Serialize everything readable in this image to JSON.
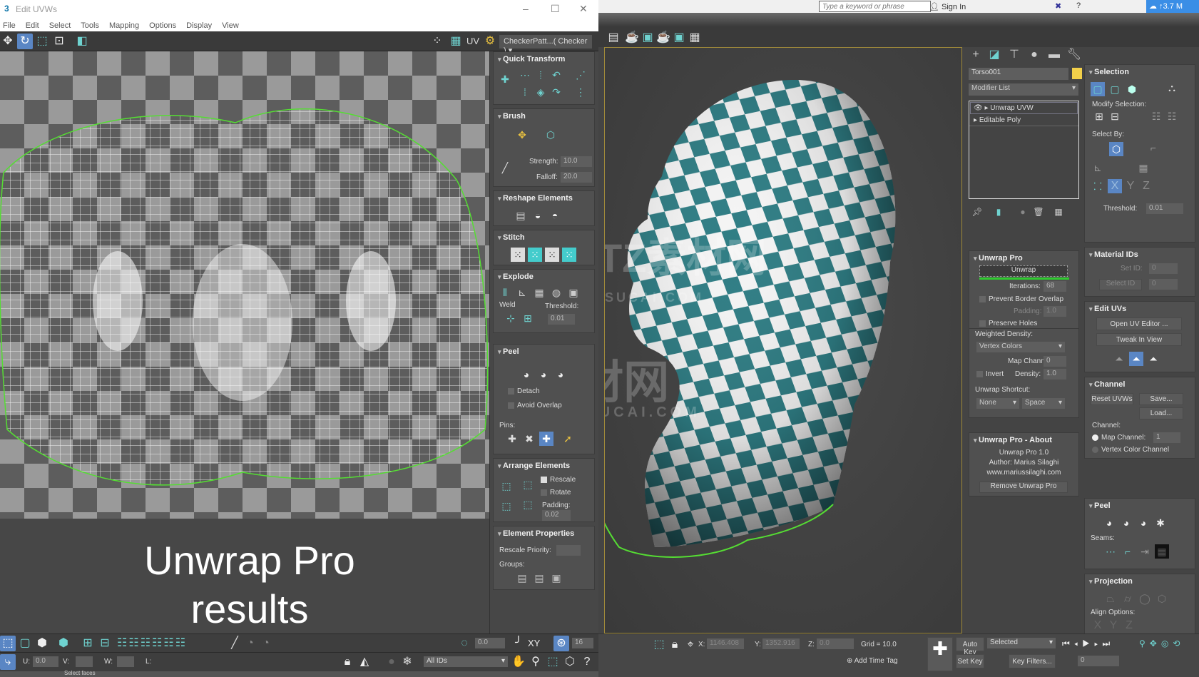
{
  "uv_editor": {
    "title": "Edit UVWs",
    "logo": "3",
    "window_controls": [
      "–",
      "☐",
      "✕"
    ],
    "menu": [
      "File",
      "Edit",
      "Select",
      "Tools",
      "Mapping",
      "Options",
      "Display",
      "View"
    ],
    "uv_label": "UV",
    "checker_select": "CheckerPatt...( Checker )",
    "overlay_text_line1": "Unwrap Pro",
    "overlay_text_line2": "results",
    "rollouts": {
      "quick_transform": "Quick Transform",
      "brush": {
        "title": "Brush",
        "strength_label": "Strength:",
        "strength": "10.0",
        "falloff_label": "Falloff:",
        "falloff": "20.0"
      },
      "reshape": "Reshape Elements",
      "stitch": "Stitch",
      "explode": {
        "title": "Explode",
        "weld": "Weld",
        "threshold_label": "Threshold:",
        "threshold": "0.01"
      },
      "peel": {
        "title": "Peel",
        "detach": "Detach",
        "avoid_overlap": "Avoid Overlap",
        "pins": "Pins:"
      },
      "arrange": {
        "title": "Arrange Elements",
        "rescale": "Rescale",
        "rotate": "Rotate",
        "padding_label": "Padding:",
        "padding": "0.02"
      },
      "element_properties": {
        "title": "Element Properties",
        "rescale_priority": "Rescale Priority:",
        "groups": "Groups:"
      }
    },
    "bottom": {
      "angle": "0.0",
      "xy": "XY",
      "count": "16",
      "u_label": "U:",
      "u": "0.0",
      "v_label": "V:",
      "w_label": "W:",
      "l_label": "L:",
      "ids": "All IDs",
      "status": "Select faces"
    }
  },
  "max": {
    "search_placeholder": "Type a keyword or phrase",
    "sign_in": "Sign In",
    "upload": "3.7 M",
    "object_name": "Torso001",
    "object_color": "#f2d04a",
    "modifier_list": "Modifier List",
    "stack": [
      "Unwrap UVW",
      "Editable Poly"
    ],
    "unwrap_pro": {
      "title": "Unwrap Pro",
      "unwrap_btn": "Unwrap",
      "progress": 1.0,
      "iterations_label": "Iterations:",
      "iterations": "68",
      "prevent_border": "Prevent Border Overlap",
      "padding_label": "Padding:",
      "padding": "1.0",
      "preserve_holes": "Preserve Holes",
      "weighted_density": "Weighted Density:",
      "density_source": "Vertex Colors",
      "map_channel_label": "Map Channel:",
      "map_channel": "0",
      "invert": "Invert",
      "density_label": "Density:",
      "density": "1.0",
      "shortcut_label": "Unwrap Shortcut:",
      "shortcut_mod": "None",
      "shortcut_key": "Space"
    },
    "about": {
      "title": "Unwrap Pro - About",
      "version": "Unwrap Pro 1.0",
      "author": "Author: Marius Silaghi",
      "url": "www.mariussilaghi.com",
      "remove": "Remove Unwrap Pro"
    },
    "selection": {
      "title": "Selection",
      "modify": "Modify Selection:",
      "select_by": "Select By:",
      "threshold_label": "Threshold:",
      "threshold": "0.01",
      "axes": [
        "X",
        "Y",
        "Z"
      ]
    },
    "material_ids": {
      "title": "Material IDs",
      "set_id": "Set ID:",
      "set_val": "0",
      "select_id": "Select ID",
      "select_val": "0"
    },
    "edit_uvs": {
      "title": "Edit UVs",
      "open": "Open UV Editor ...",
      "tweak": "Tweak In View"
    },
    "channel": {
      "title": "Channel",
      "reset": "Reset UVWs",
      "save": "Save...",
      "load": "Load...",
      "group": "Channel:",
      "map_channel": "Map Channel:",
      "map_val": "1",
      "vertex_color": "Vertex Color Channel"
    },
    "peel": {
      "title": "Peel",
      "seams": "Seams:"
    },
    "projection": {
      "title": "Projection",
      "align": "Align Options:",
      "axes": [
        "X",
        "Y",
        "Z"
      ]
    },
    "status": {
      "x_label": "X:",
      "x": "1146.408",
      "y_label": "Y:",
      "y": "1352.916",
      "z_label": "Z:",
      "z": "0.0",
      "grid": "Grid = 10.0",
      "add_time_tag": "Add Time Tag",
      "auto_key": "Auto Key",
      "selected": "Selected",
      "set_key": "Set Key",
      "key_filters": "Key Filters...",
      "frame": "0"
    }
  },
  "watermark": {
    "cn": "TZ素材网",
    "en": "TZSUCAI.COM"
  },
  "colors": {
    "accent": "#5a86c4",
    "teal": "#6fd3d0",
    "checker_teal": "#2f7d84",
    "viewport_border": "#a08a3a",
    "uv_border": "#55dd33"
  }
}
